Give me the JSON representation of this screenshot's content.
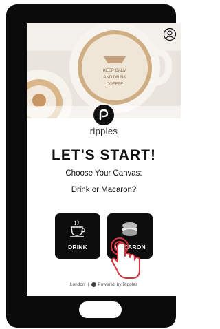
{
  "brand": {
    "name": "ripples"
  },
  "hero": {
    "mug_text": "KEEP CALM AND DRINK COFFEE"
  },
  "main": {
    "title": "LET'S START!",
    "subtitle_line1": "Choose Your Canvas:",
    "subtitle_line2": "Drink or Macaron?"
  },
  "options": [
    {
      "label": "DRINK",
      "icon": "coffee-cup-icon"
    },
    {
      "label": "MACARON",
      "icon": "macaron-icon"
    }
  ],
  "footer": {
    "location": "London",
    "separator": "|",
    "powered": "Powered by Ripples"
  },
  "icons": {
    "account": "account-icon",
    "touch": "hand-pointer-icon"
  },
  "colors": {
    "frame": "#0b0b0b",
    "card": "#0d0d0d",
    "touch_ring": "#d8303c"
  }
}
